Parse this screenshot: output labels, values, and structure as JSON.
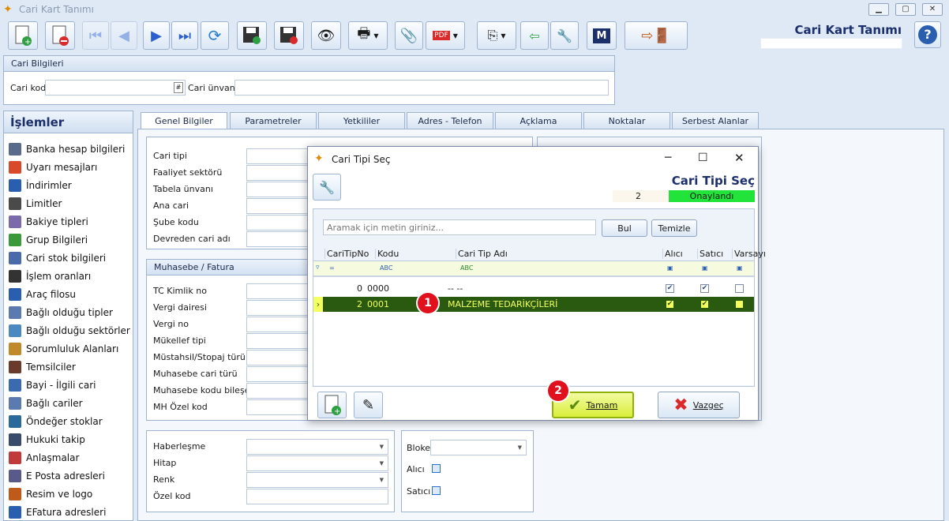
{
  "window": {
    "title": "Cari Kart Tanımı"
  },
  "header": {
    "title": "Cari Kart Tanımı"
  },
  "cari_bilgileri": {
    "title": "Cari Bilgileri",
    "kod_label": "Cari kod",
    "unvan_label": "Cari ünvanı",
    "kod_hash": "#"
  },
  "side": {
    "title": "İşlemler",
    "items": [
      "Banka hesap bilgileri",
      "Uyarı mesajları",
      "İndirimler",
      "Limitler",
      "Bakiye tipleri",
      "Grup Bilgileri",
      "Cari stok bilgileri",
      "İşlem oranları",
      "Araç filosu",
      "Bağlı olduğu tipler",
      "Bağlı olduğu sektörler",
      "Sorumluluk Alanları",
      "Temsilciler",
      "Bayi - İlgili cari",
      "Bağlı cariler",
      "Öndeğer stoklar",
      "Hukuki takip",
      "Anlaşmalar",
      "E Posta adresleri",
      "Resim ve logo",
      "EFatura adresleri"
    ]
  },
  "tabs": [
    "Genel Bilgiler",
    "Parametreler",
    "Yetkililer",
    "Adres - Telefon",
    "Açklama",
    "Noktalar",
    "Serbest Alanlar"
  ],
  "genel": {
    "fields": [
      "Cari tipi",
      "Faaliyet sektörü",
      "Tabela ünvanı",
      "Ana cari",
      "Şube kodu",
      "Devreden cari adı"
    ]
  },
  "muhasebe": {
    "title": "Muhasebe / Fatura",
    "fields": [
      "TC Kimlik no",
      "Vergi dairesi",
      "Vergi no",
      "Mükellef tipi",
      "Müstahsil/Stopaj türü",
      "Muhasebe cari türü",
      "Muhasebe kodu bileşeni",
      "MH Özel kod"
    ]
  },
  "other": {
    "fields": [
      "Haberleşme",
      "Hitap",
      "Renk",
      "Özel kod"
    ],
    "bloke": "Bloke",
    "alici": "Alıcı",
    "satici": "Satıcı"
  },
  "dialog": {
    "title": "Cari Tipi Seç",
    "header_title": "Cari Tipi Seç",
    "count": "2",
    "status": "Onaylandı",
    "status_color": "#22e33a",
    "search_placeholder": "Aramak için metin giriniz...",
    "bul": "Bul",
    "temizle": "Temizle",
    "columns": [
      "CariTipNo",
      "Kodu",
      "Cari Tip Adı",
      "Alıcı",
      "Satıcı",
      "Varsayıla"
    ],
    "rows": [
      {
        "no": "0",
        "kodu": "0000",
        "adi": "-- --",
        "alici": true,
        "satici": true,
        "varsayilan": false
      },
      {
        "no": "2",
        "kodu": "0001",
        "adi": "MALZEME TEDARİKÇİLERİ",
        "alici": true,
        "satici": true,
        "varsayilan": false
      }
    ],
    "tamam": "Tamam",
    "vazgec": "Vazgeç",
    "badge1": "1",
    "badge2": "2"
  }
}
